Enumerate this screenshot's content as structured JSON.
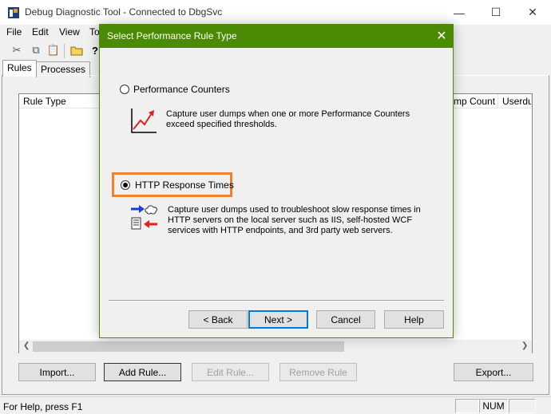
{
  "window": {
    "title": "Debug Diagnostic Tool - Connected to DbgSvc",
    "minimize_glyph": "—",
    "maximize_glyph": "☐",
    "close_glyph": "✕"
  },
  "menu": [
    "File",
    "Edit",
    "View",
    "To"
  ],
  "tabs": [
    {
      "label": "Rules",
      "active": true
    },
    {
      "label": "Processes",
      "active": false
    }
  ],
  "list": {
    "columns": [
      "Rule Type",
      "mp Count",
      "Userdu"
    ]
  },
  "buttons": {
    "import": "Import...",
    "add_rule": "Add Rule...",
    "edit_rule": "Edit Rule...",
    "remove_rule": "Remove Rule",
    "export": "Export..."
  },
  "statusbar": {
    "text": "For Help, press F1",
    "num": "NUM"
  },
  "dialog": {
    "title": "Select Performance Rule Type",
    "close_glyph": "✕",
    "options": [
      {
        "label": "Performance Counters",
        "selected": false,
        "description": "Capture user dumps when one or more Performance Counters exceed specified thresholds.",
        "icon": "rising-graph-icon"
      },
      {
        "label": "HTTP Response Times",
        "selected": true,
        "description": "Capture user dumps used to troubleshoot slow response times in HTTP servers on the local server such as IIS, self-hosted WCF services with HTTP endpoints, and 3rd party web servers.",
        "icon": "http-request-response-icon"
      }
    ],
    "buttons": {
      "back": "< Back",
      "next": "Next >",
      "cancel": "Cancel",
      "help": "Help"
    }
  },
  "colors": {
    "dialog_title_bar": "#4b8b04",
    "highlight_box": "#f0822d"
  }
}
